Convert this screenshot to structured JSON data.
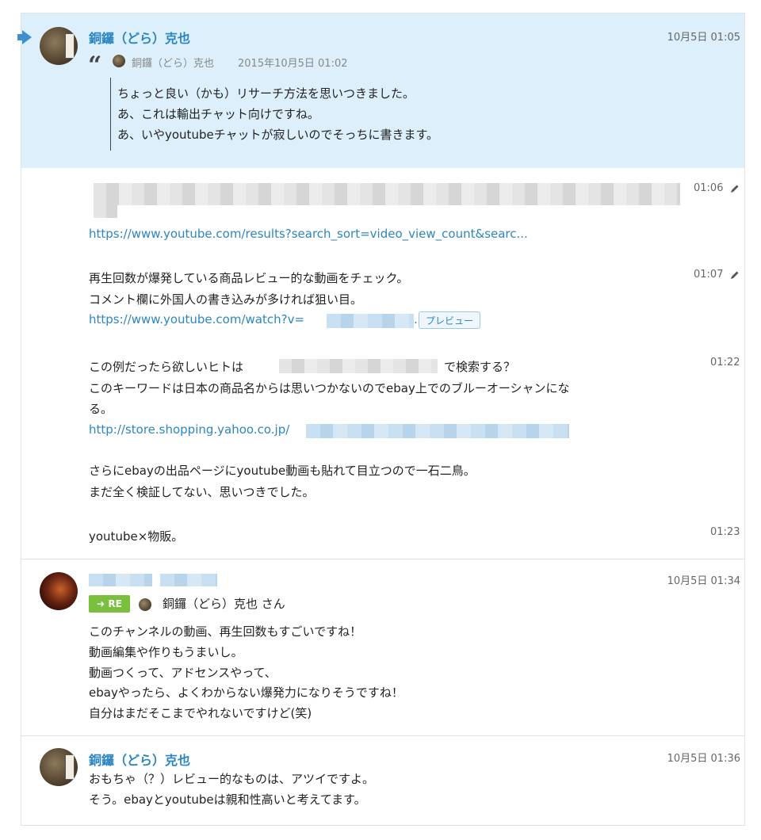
{
  "messages": [
    {
      "author": "銅鑼（どら）克也",
      "time": "10月5日 01:05",
      "quote": {
        "author": "銅鑼（どら）克也",
        "date": "2015年10月5日 01:02",
        "lines": [
          "ちょっと良い（かも）リサーチ方法を思いつきました。",
          "あ、これは輸出チャット向けですね。",
          "あ、いやyoutubeチャットが寂しいのでそっちに書きます。"
        ]
      }
    },
    {
      "time": "01:06",
      "link": "https://www.youtube.com/results?search_sort=video_view_count&searc..."
    },
    {
      "time": "01:07",
      "lines": [
        "再生回数が爆発している商品レビュー的な動画をチェック。",
        "コメント欄に外国人の書き込みが多ければ狙い目。"
      ],
      "link": "https://www.youtube.com/watch?v=",
      "link_suffix": ".",
      "preview_label": "プレビュー"
    },
    {
      "time": "01:22",
      "line1_prefix": "この例だったら欲しいヒトは",
      "line1_suffix": "で検索する？",
      "line2": "このキーワードは日本の商品名からは思いつかないのでebay上でのブルーオーシャンにな",
      "line3": "る。",
      "link": "http://store.shopping.yahoo.co.jp/",
      "after_lines": [
        "さらにebayの出品ページにyoutube動画も貼れて目立つので一石二鳥。",
        "まだ全く検証してない、思いつきでした。"
      ]
    },
    {
      "time": "01:23",
      "text": "youtube×物販。"
    },
    {
      "time": "10月5日 01:34",
      "re_label": "RE",
      "re_to": "銅鑼（どら）克也 さん",
      "lines": [
        "このチャンネルの動画、再生回数もすごいですね！",
        "動画編集や作りもうまいし。",
        "動画つくって、アドセンスやって、",
        "ebayやったら、よくわからない爆発力になりそうですね！",
        "自分はまだそこまでやれないですけど(笑)"
      ]
    },
    {
      "author": "銅鑼（どら）克也",
      "time": "10月5日 01:36",
      "lines": [
        "おもちゃ（？）レビュー的なものは、アツイですよ。",
        "そう。ebayとyoutubeは親和性高いと考えてます。"
      ]
    }
  ],
  "icons": {
    "quote": "“",
    "pencil": "pencil-icon",
    "arrow": "arrow-right-icon",
    "re_arrow": "➜"
  },
  "colors": {
    "highlight_bg": "#dceffb",
    "name": "#2a86c2",
    "link": "#2d86c2",
    "re_badge": "#7bbf3e"
  }
}
